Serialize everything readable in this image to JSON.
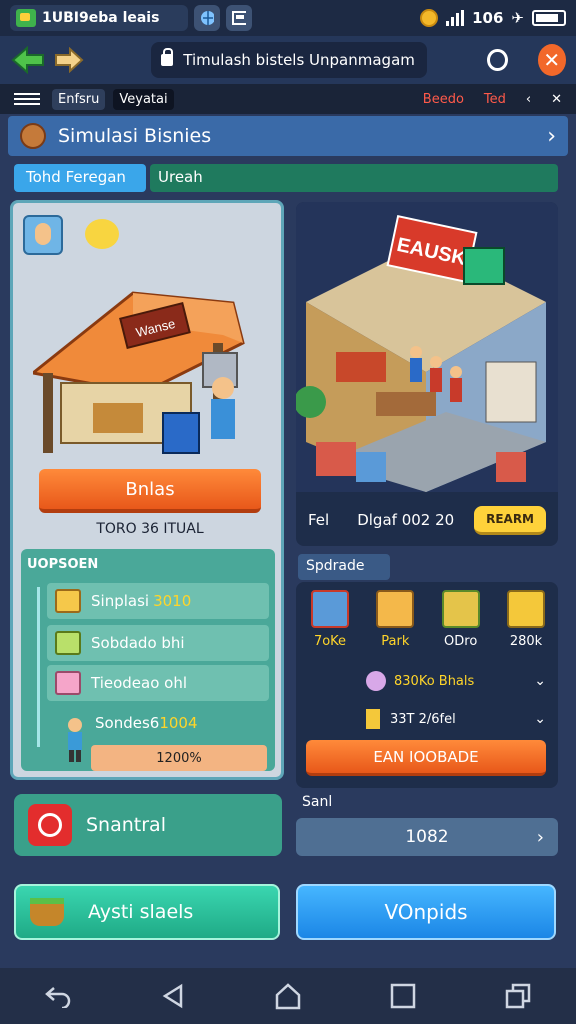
{
  "status_bar": {
    "app_title": "1UBI9eba leais",
    "time": "106"
  },
  "browser": {
    "url": "Timulash bistels Unpanmagam"
  },
  "tabs_row": {
    "tab1": "Enfsru",
    "tab2": "Veyatai",
    "right1": "Beedo",
    "right2": "Ted"
  },
  "header": {
    "title": "Simulasi Bisnies"
  },
  "modes": {
    "active": "Tohd Feregan",
    "other": "Ureah"
  },
  "left_panel": {
    "stall_sign": "Wanse",
    "business_button": "Bnlas",
    "stat": "TORO 36 ITUAL",
    "upgrades": {
      "title": "UOPSOEN",
      "items": [
        {
          "label": "Sinplasi",
          "value": "3010"
        },
        {
          "label": "Sobdado bhi",
          "value": ""
        },
        {
          "label": "Tieodeao ohl",
          "value": ""
        },
        {
          "label": "Sondes6",
          "value": "1004"
        }
      ],
      "progress_label": "1200%"
    }
  },
  "right_panel": {
    "shop_sign": "EAUSK",
    "foot_left": "Fel",
    "foot_value": "Dlgaf 002 20",
    "foot_button": "REARM",
    "section_label": "Spdrade",
    "shop_items": [
      "7oKe",
      "Park",
      "ODro",
      "280k"
    ],
    "drops": [
      {
        "label": "830Ko Bhals"
      },
      {
        "label": "33T 2/6fel"
      }
    ],
    "earn_button": "EAN IOOBADE"
  },
  "bottom": {
    "green_card": "Snantral",
    "sani_label": "Sanl",
    "blue_card_value": "1082",
    "green_button": "Aysti slaels",
    "blue_button": "VOnpids"
  }
}
